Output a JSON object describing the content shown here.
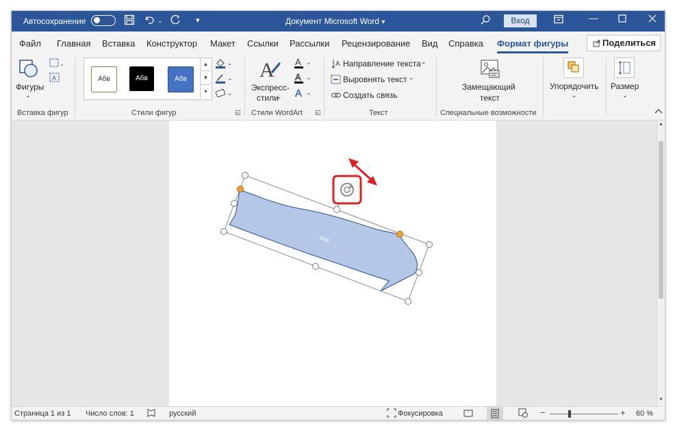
{
  "titlebar": {
    "autosave_label": "Автосохранение",
    "doc_title": "Документ Microsoft Word",
    "doc_title_arrow": "▾",
    "signin_label": "Вход"
  },
  "tabs": [
    {
      "label": "Файл"
    },
    {
      "label": "Главная"
    },
    {
      "label": "Вставка"
    },
    {
      "label": "Конструктор"
    },
    {
      "label": "Макет"
    },
    {
      "label": "Ссылки"
    },
    {
      "label": "Рассылки"
    },
    {
      "label": "Рецензирование"
    },
    {
      "label": "Вид"
    },
    {
      "label": "Справка"
    },
    {
      "label": "Формат фигуры"
    }
  ],
  "share_label": "Поделиться",
  "ribbon": {
    "insert_shapes": {
      "shapes_label": "Фигуры",
      "group_label": "Вставка фигур"
    },
    "shape_styles": {
      "samples": [
        "Абв",
        "Абв",
        "Абв"
      ],
      "group_label": "Стили фигур"
    },
    "wordart": {
      "express_line1": "Экспресс-",
      "express_line2": "стили",
      "group_label": "Стили WordArt",
      "letter": "A"
    },
    "text": {
      "direction_label": "Направление текста",
      "align_label": "Выровнять текст",
      "link_label": "Создать связь",
      "group_label": "Текст"
    },
    "accessibility": {
      "alt_line1": "Замещающий",
      "alt_line2": "текст",
      "group_label": "Специальные возможности"
    },
    "arrange_label": "Упорядочить",
    "size_label": "Размер"
  },
  "shape": {
    "text": "щщ"
  },
  "statusbar": {
    "page": "Страница 1 из 1",
    "words": "Число слов: 1",
    "language": "русский",
    "focus": "Фокусировка",
    "zoom": "60 %",
    "minus": "−",
    "plus": "+"
  },
  "colors": {
    "brand": "#2b579a",
    "arrow_fill": "#b4c7e7",
    "highlight": "#e02020",
    "handle": "#f0a030"
  }
}
